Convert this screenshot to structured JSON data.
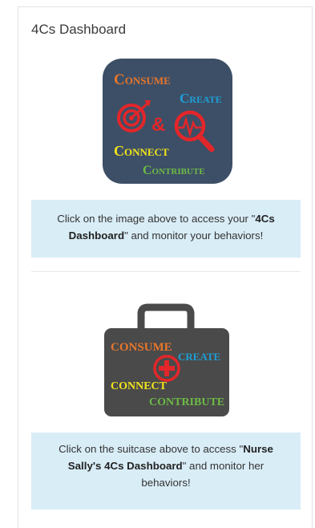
{
  "card": {
    "title": "4Cs Dashboard"
  },
  "logo_image": {
    "icon": "4cs-logo-icon",
    "words": [
      "Consume",
      "Create",
      "&",
      "Connect",
      "Contribute"
    ],
    "colors": {
      "background": "#3d4f66",
      "consume": "#e8762b",
      "create": "#1e9fd8",
      "ampersand": "#e3262a",
      "connect": "#f2e51b",
      "contribute": "#6dbb45"
    }
  },
  "notice1": {
    "before": "Click on the image above to access your \"",
    "bold": "4Cs Dashboard",
    "after": "\" and monitor your behaviors!"
  },
  "suitcase_image": {
    "icon": "suitcase-icon",
    "words": [
      "CONSUME",
      "CREATE",
      "CONNECT",
      "CONTRIBUTE"
    ],
    "colors": {
      "body": "#4a4a4a",
      "consume": "#e8762b",
      "create": "#1e9fd8",
      "cross": "#e3262a",
      "connect": "#f2e51b",
      "contribute": "#6dbb45"
    }
  },
  "notice2": {
    "before": "Click on the suitcase above to access \"",
    "bold": "Nurse Sally's 4Cs Dashboard",
    "after": "\" and monitor her behaviors!"
  },
  "colors": {
    "notice_bg": "#d9edf7",
    "border": "#e3e3e3"
  }
}
